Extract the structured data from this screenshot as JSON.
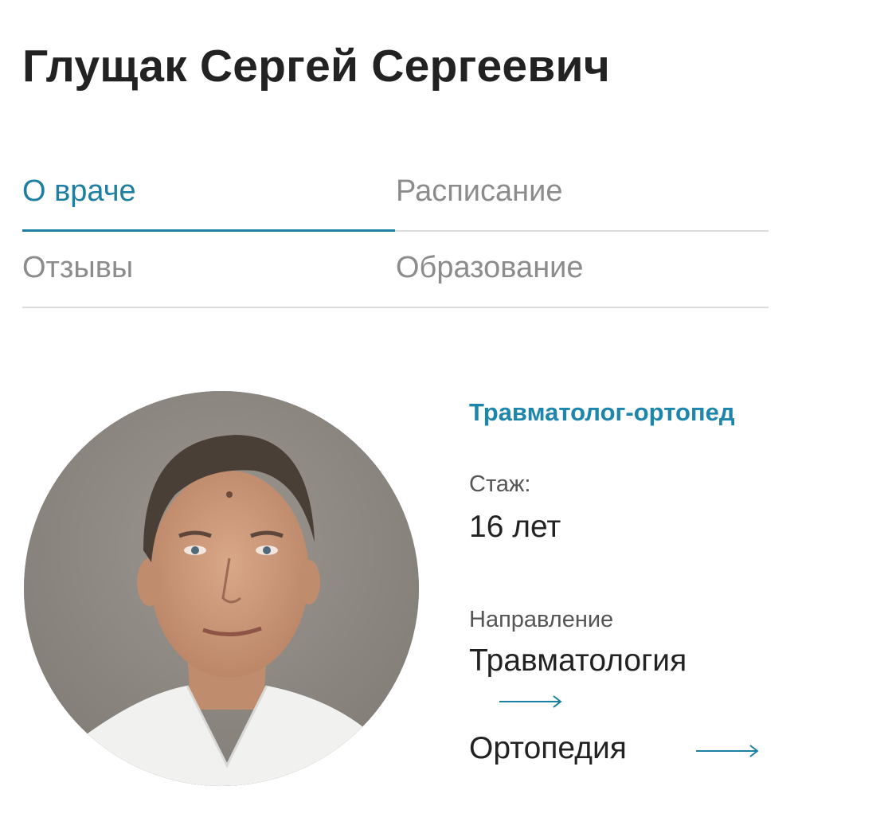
{
  "doctor": {
    "name": "Глущак Сергей Сергеевич",
    "specialty": "Травматолог-ортопед",
    "experience_label": "Стаж:",
    "experience_value": "16 лет",
    "direction_label": "Направление",
    "directions": [
      "Травматология",
      "Ортопедия"
    ]
  },
  "tabs": [
    {
      "label": "О враче",
      "active": true
    },
    {
      "label": "Расписание",
      "active": false
    },
    {
      "label": "Отзывы",
      "active": false
    },
    {
      "label": "Образование",
      "active": false
    }
  ],
  "colors": {
    "accent": "#1d7fa1",
    "text": "#222222",
    "muted": "#8c8c8c",
    "divider": "#dcdcdc"
  },
  "icons": [
    "arrow-right-icon"
  ]
}
